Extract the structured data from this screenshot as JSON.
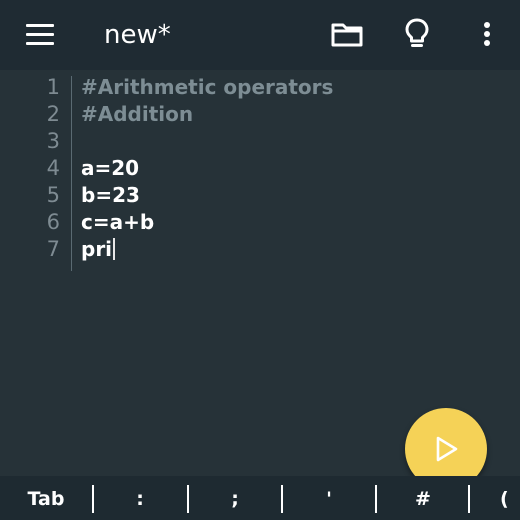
{
  "app_bar": {
    "title": "new*",
    "icons": [
      "menu-icon",
      "folder-icon",
      "lightbulb-icon",
      "more-vert-icon"
    ]
  },
  "editor": {
    "lines": [
      {
        "num": "1",
        "text": "#Arithmetic operators",
        "kind": "comment"
      },
      {
        "num": "2",
        "text": "#Addition",
        "kind": "comment"
      },
      {
        "num": "3",
        "text": "",
        "kind": "normal"
      },
      {
        "num": "4",
        "text": "a=20",
        "kind": "normal"
      },
      {
        "num": "5",
        "text": "b=23",
        "kind": "normal"
      },
      {
        "num": "6",
        "text": "c=a+b",
        "kind": "normal"
      },
      {
        "num": "7",
        "text": "pri",
        "kind": "normal"
      }
    ]
  },
  "fab": {
    "icon": "play-icon",
    "color": "#f5d257"
  },
  "keybar": {
    "keys": [
      "Tab",
      ":",
      ";",
      "'",
      "#",
      "("
    ]
  },
  "colors": {
    "background": "#263238",
    "app_bar": "#1f2b33",
    "comment": "#7d8d94",
    "line_number": "#7e8b92"
  }
}
